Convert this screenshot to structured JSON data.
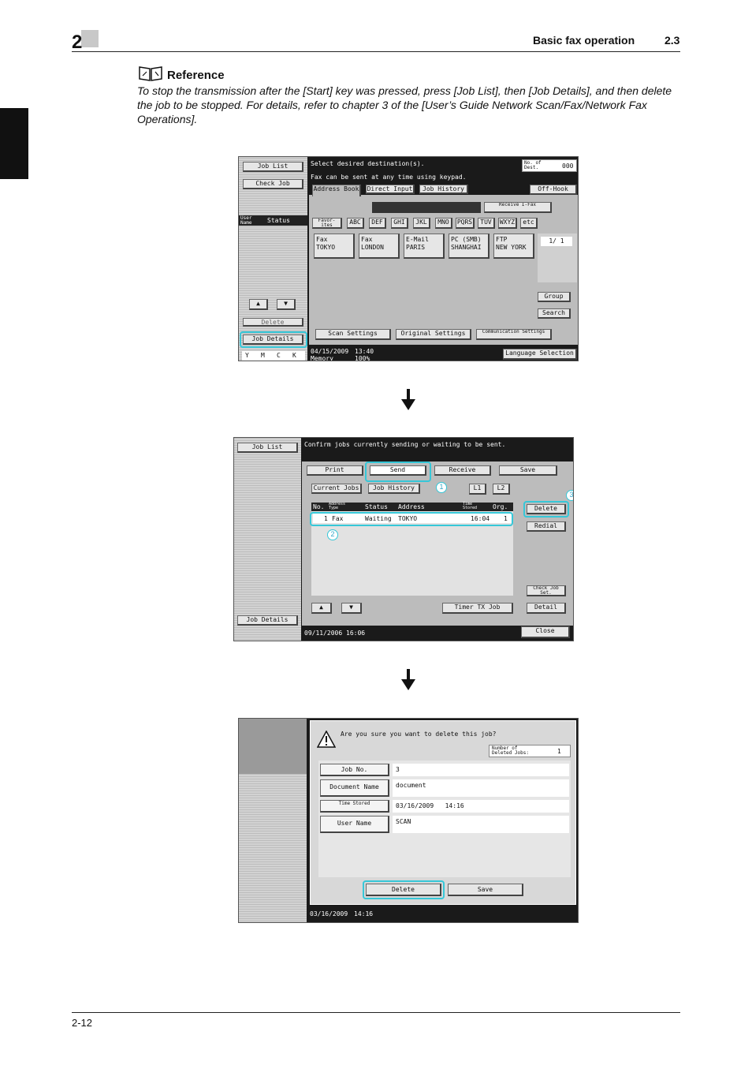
{
  "header": {
    "chapter": "2",
    "title": "Basic fax operation",
    "section": "2.3"
  },
  "reference": {
    "title": "Reference",
    "body": "To stop the transmission after the [Start] key was pressed, press [Job List], then [Job Details], and then delete the job to be stopped. For details, refer to chapter 3 of the [User’s Guide Network Scan/Fax/Network Fax Operations]."
  },
  "shot1": {
    "job_list": "Job List",
    "check_job": "Check Job",
    "user_name": "User Name",
    "status": "Status",
    "delete": "Delete",
    "job_details": "Job Details",
    "toner": [
      "Y",
      "M",
      "C",
      "K"
    ],
    "message1": "Select desired destination(s).",
    "message2": "Fax can be sent at any time using keypad.",
    "no_of_dest": "No. of Dest.",
    "dest_count": "000",
    "tabs": [
      "Address Book",
      "Direct Input",
      "Job History"
    ],
    "off_hook": "Off-Hook",
    "receive_ifax": "Receive I-Fax",
    "index": [
      "Favor-ites",
      "ABC",
      "DEF",
      "GHI",
      "JKL",
      "MNO",
      "PQRS",
      "TUV",
      "WXYZ",
      "etc"
    ],
    "destinations": [
      {
        "type": "Fax",
        "name": "TOKYO"
      },
      {
        "type": "Fax",
        "name": "LONDON"
      },
      {
        "type": "E-Mail",
        "name": "PARIS"
      },
      {
        "type": "PC (SMB)",
        "name": "SHANGHAI"
      },
      {
        "type": "FTP",
        "name": "NEW YORK"
      }
    ],
    "page": "1/ 1",
    "group": "Group",
    "search": "Search",
    "scan_settings": "Scan Settings",
    "original_settings": "Original Settings",
    "communication_settings": "Communication Settings",
    "date": "04/15/2009",
    "time": "13:40",
    "memory_label": "Memory",
    "memory": "100%",
    "language_selection": "Language Selection"
  },
  "shot2": {
    "job_list": "Job List",
    "job_details": "Job Details",
    "message": "Confirm jobs currently sending or waiting to be sent.",
    "tabs": [
      "Print",
      "Send",
      "Receive",
      "Save"
    ],
    "current_jobs": "Current Jobs",
    "job_history": "Job History",
    "l1": "L1",
    "l2": "L2",
    "columns": [
      "No.",
      "Address Type",
      "Status",
      "Address",
      "Time Stored",
      "Org."
    ],
    "row": {
      "no": "1",
      "type": "Fax",
      "status": "Waiting",
      "address": "TOKYO",
      "time": "16:04",
      "org": "1"
    },
    "delete": "Delete",
    "redial": "Redial",
    "check_job_set": "Check Job Set.",
    "timer_tx": "Timer TX Job",
    "detail": "Detail",
    "close": "Close",
    "date": "09/11/2006",
    "time": "16:06",
    "callouts": [
      "1",
      "2",
      "3"
    ]
  },
  "shot3": {
    "question": "Are you sure you want to delete this job?",
    "deleted_label": "Number of Deleted Jobs:",
    "deleted_count": "1",
    "fields": [
      {
        "label": "Job No.",
        "value": "3"
      },
      {
        "label": "Document Name",
        "value": "document"
      },
      {
        "label": "Time Stored",
        "value": "03/16/2009   14:16"
      },
      {
        "label": "User Name",
        "value": "SCAN"
      }
    ],
    "delete": "Delete",
    "save": "Save",
    "date": "03/16/2009",
    "time": "14:16"
  },
  "footer": {
    "page": "2-12"
  }
}
